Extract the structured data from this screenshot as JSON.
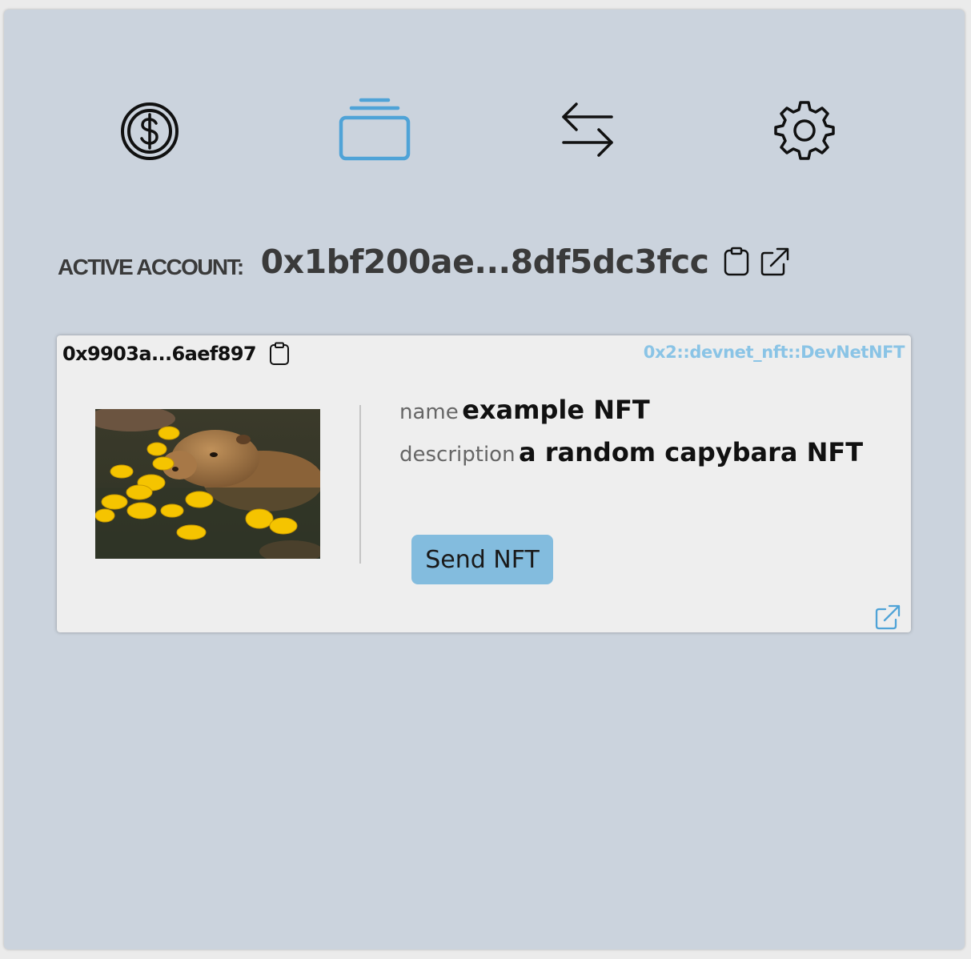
{
  "nav": {
    "items": [
      {
        "name": "coins",
        "icon": "coin-icon",
        "active": false
      },
      {
        "name": "nfts",
        "icon": "stack-icon",
        "active": true
      },
      {
        "name": "transactions",
        "icon": "arrows-left-right-icon",
        "active": false
      },
      {
        "name": "settings",
        "icon": "gear-icon",
        "active": false
      }
    ],
    "active_color": "#4fa3d7"
  },
  "account": {
    "label": "ACTIVE ACCOUNT:",
    "address": "0x1bf200ae...8df5dc3fcc",
    "copy_icon": "clipboard-icon",
    "link_icon": "external-link-icon"
  },
  "nft": {
    "object_id": "0x9903a...6aef897",
    "type": "0x2::devnet_nft::DevNetNFT",
    "image_icon": "capybara-photo",
    "fields": [
      {
        "key": "name",
        "value": "example NFT"
      },
      {
        "key": "description",
        "value": "a random capybara NFT"
      }
    ],
    "send_label": "Send NFT",
    "link_icon": "external-link-icon"
  },
  "colors": {
    "background": "#cbd3dd",
    "card": "#eeeeee",
    "accent": "#4fa3d7",
    "type_text": "#8ac4e6",
    "button": "#83bcde"
  }
}
